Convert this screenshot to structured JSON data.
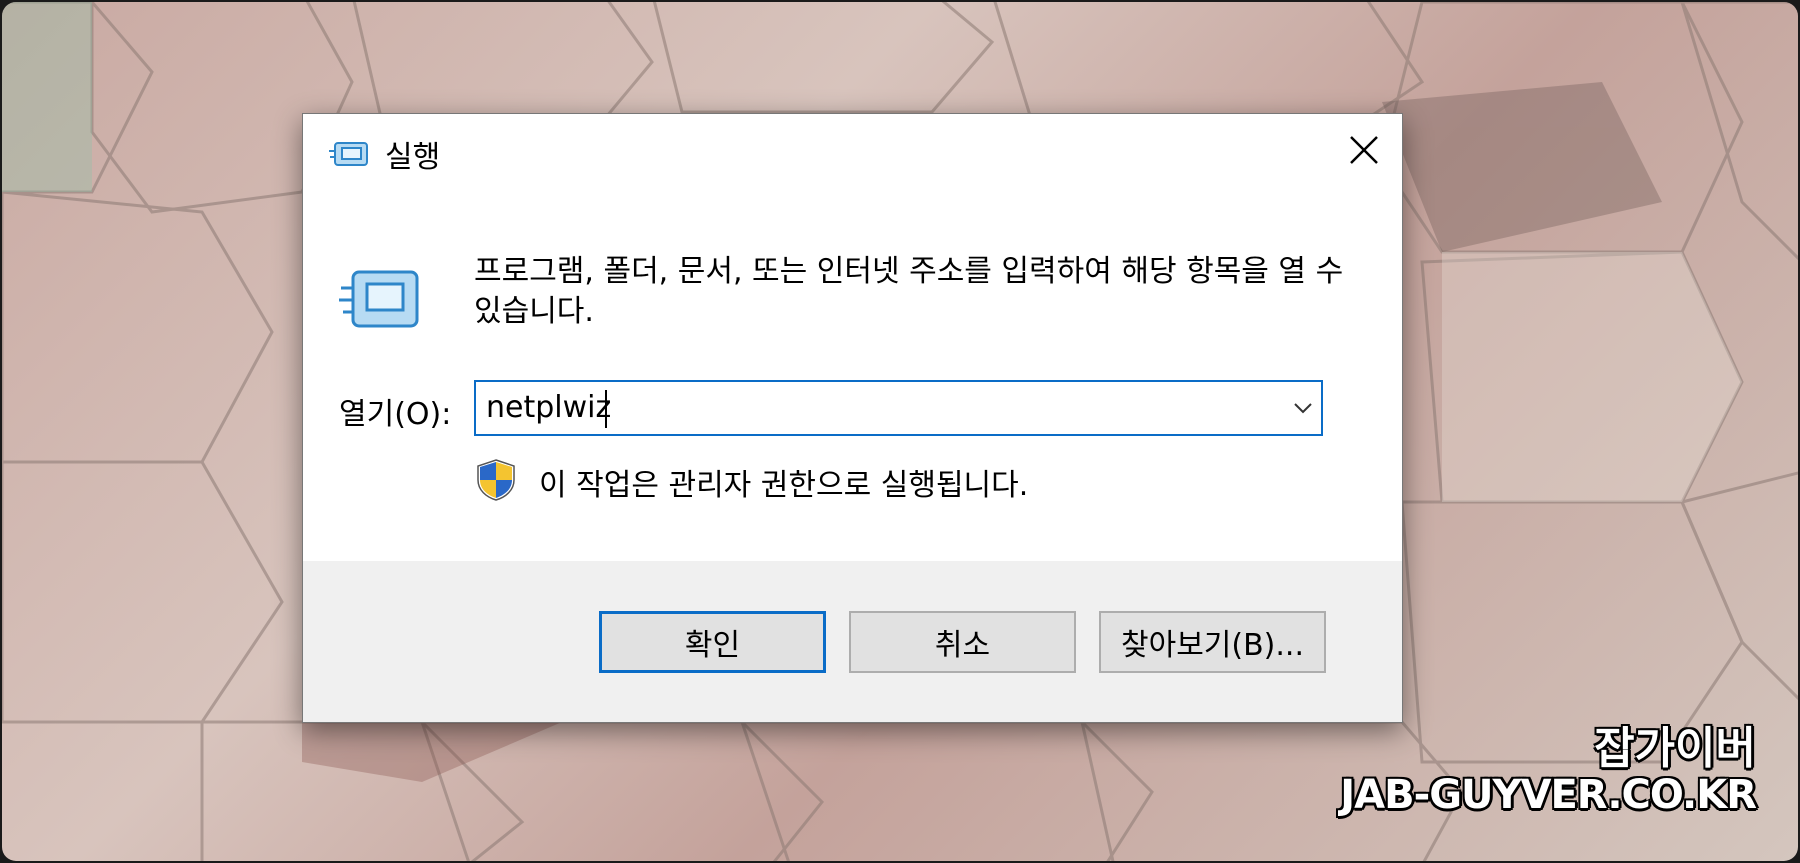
{
  "dialog": {
    "title": "실행",
    "description": "프로그램, 폴더, 문서, 또는 인터넷 주소를 입력하여 해당 항목을 열 수 있습니다.",
    "open_label": "열기(O):",
    "open_value": "netplwiz",
    "admin_notice": "이 작업은 관리자 권한으로 실행됩니다.",
    "buttons": {
      "ok": "확인",
      "cancel": "취소",
      "browse": "찾아보기(B)..."
    }
  },
  "watermark": {
    "line1": "잡가이버",
    "line2": "JAB-GUYVER.CO.KR"
  },
  "colors": {
    "accent": "#0a6cc7",
    "footer_bg": "#f0f0f0",
    "button_bg": "#e1e1e1"
  },
  "icons": [
    "run-icon",
    "close-icon",
    "chevron-down-icon",
    "uac-shield-icon"
  ]
}
